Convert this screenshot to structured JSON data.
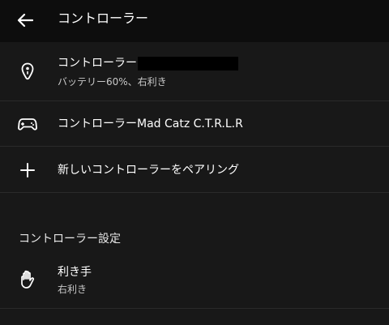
{
  "appbar": {
    "title": "コントローラー",
    "back_icon": "arrow-left-icon"
  },
  "rows": [
    {
      "icon": "controller-remote-icon",
      "title": "コントローラー",
      "subtitle": "バッテリー60%、右利き"
    },
    {
      "icon": "gamepad-icon",
      "title": "コントローラーMad Catz C.T.R.L.R"
    },
    {
      "icon": "plus-icon",
      "title": "新しいコントローラーをペアリング"
    }
  ],
  "settings": {
    "header": "コントローラー設定",
    "handedness": {
      "icon": "hand-icon",
      "title": "利き手",
      "value": "右利き"
    }
  },
  "colors": {
    "background": "#181818",
    "appbar": "#0d0d0d",
    "divider": "#2a2a2a",
    "text_primary": "#ffffff",
    "text_secondary": "#c8c8c8"
  }
}
